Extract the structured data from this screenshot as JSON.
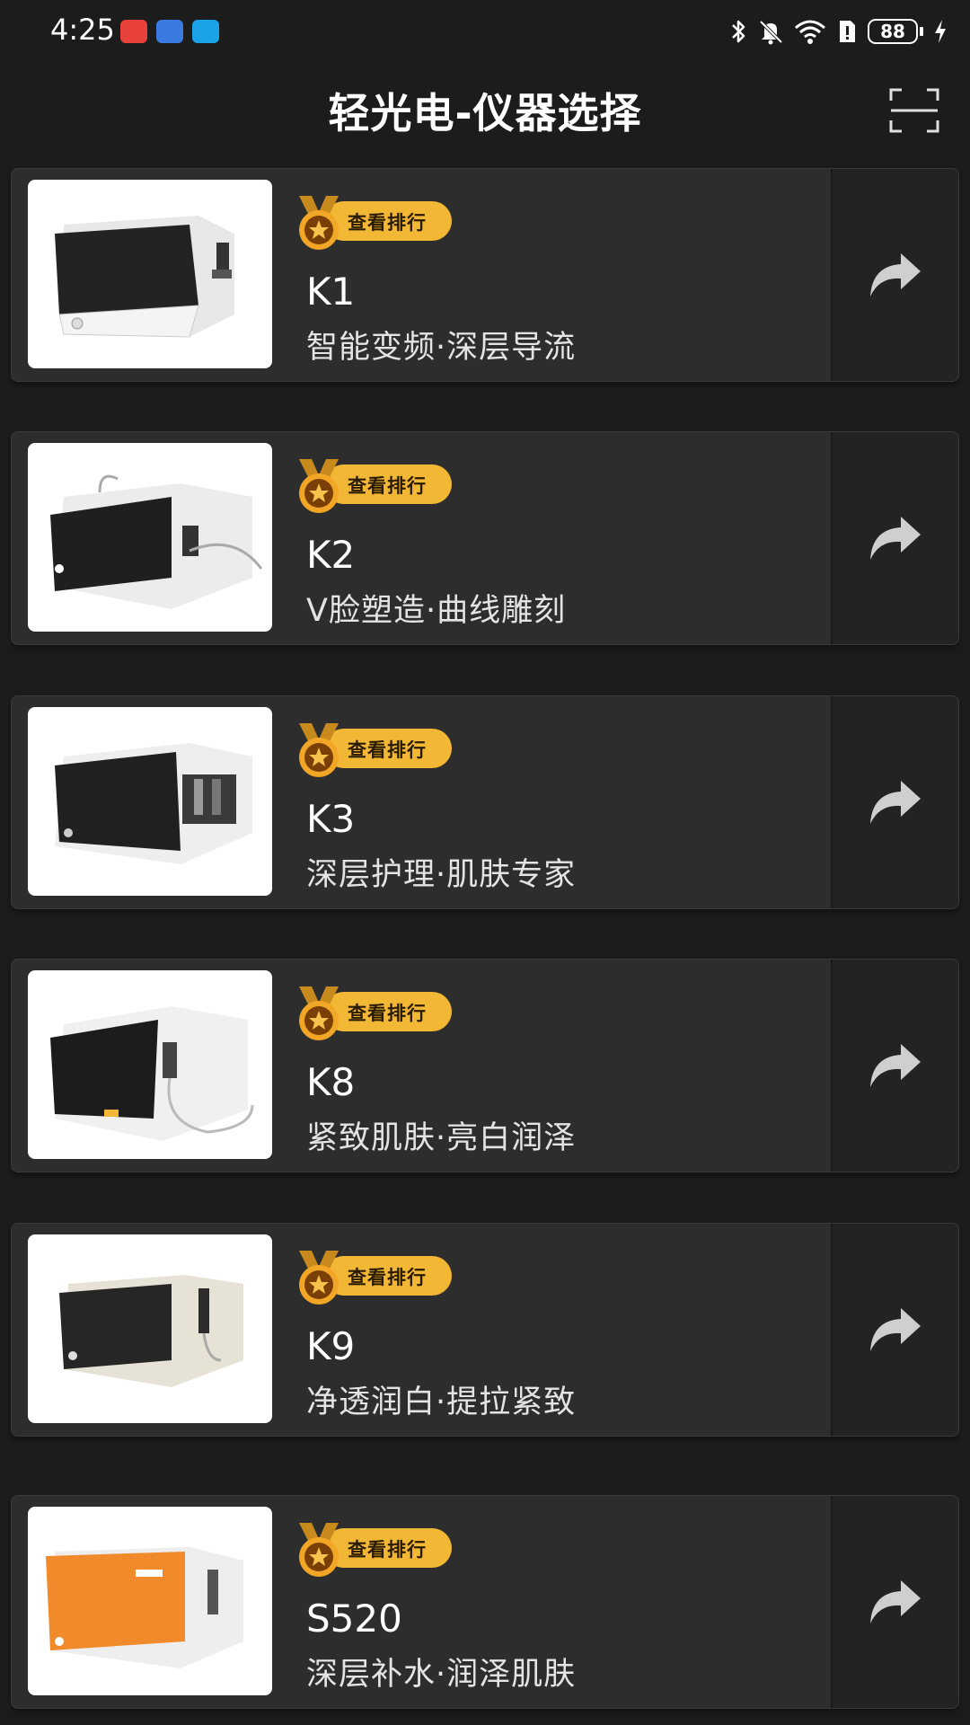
{
  "status_bar": {
    "time": "4:25",
    "battery": "88"
  },
  "header": {
    "title": "轻光电-仪器选择",
    "scan_icon": "scan-icon"
  },
  "colors": {
    "background": "#1c1c1c",
    "card": "#2d2d2d",
    "badge": "#f2b735",
    "share_panel": "#232323"
  },
  "products": [
    {
      "model": "K1",
      "desc": "智能变频·深层导流",
      "badge": "查看排行",
      "variant": "dark-handpiece"
    },
    {
      "model": "K2",
      "desc": "V脸塑造·曲线雕刻",
      "badge": "查看排行",
      "variant": "dark-cable"
    },
    {
      "model": "K3",
      "desc": "深层护理·肌肤专家",
      "badge": "查看排行",
      "variant": "dark-bottles"
    },
    {
      "model": "K8",
      "desc": "紧致肌肤·亮白润泽",
      "badge": "查看排行",
      "variant": "dark-probe"
    },
    {
      "model": "K9",
      "desc": "净透润白·提拉紧致",
      "badge": "查看排行",
      "variant": "cream-wand"
    },
    {
      "model": "S520",
      "desc": "深层补水·润泽肌肤",
      "badge": "查看排行",
      "variant": "orange-wand"
    }
  ]
}
